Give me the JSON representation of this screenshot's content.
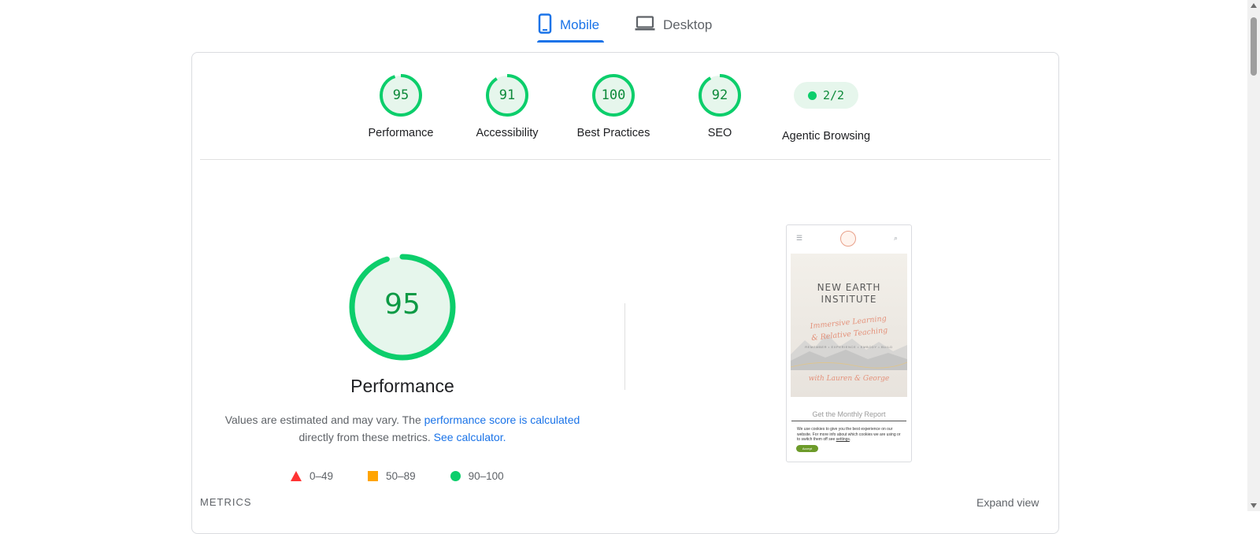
{
  "tabs": {
    "mobile": {
      "label": "Mobile",
      "icon": "smartphone-icon",
      "active": true
    },
    "desktop": {
      "label": "Desktop",
      "icon": "laptop-icon",
      "active": false
    }
  },
  "categories": [
    {
      "score": "95",
      "label": "Performance",
      "fraction": 0.95
    },
    {
      "score": "91",
      "label": "Accessibility",
      "fraction": 0.91
    },
    {
      "score": "100",
      "label": "Best Practices",
      "fraction": 1.0
    },
    {
      "score": "92",
      "label": "SEO",
      "fraction": 0.92
    }
  ],
  "agentic": {
    "value": "2/2",
    "label": "Agentic Browsing"
  },
  "performance": {
    "score": "95",
    "fraction": 0.95,
    "title": "Performance",
    "desc_part1": "Values are estimated and may vary. The ",
    "desc_link1": "performance score is calculated",
    "desc_part2": " directly from these metrics. ",
    "desc_link2": "See calculator."
  },
  "legend": {
    "fail": "0–49",
    "average": "50–89",
    "pass": "90–100"
  },
  "screenshot": {
    "title_line1": "NEW EARTH",
    "title_line2": "INSTITUTE",
    "script_line1": "Immersive Learning",
    "script_line2": "& Relative Teaching",
    "tagline": "REMEMBER • EXPERIENCE • EMBODY • BUILD",
    "author": "with Lauren & George",
    "report": "Get the Monthly Report",
    "cookie_text": "We use cookies to give you the best experience on our website. For more info about which cookies we are using or to switch them off see ",
    "cookie_link": "settings",
    "accept": "Accept"
  },
  "section": {
    "metrics": "METRICS",
    "expand": "Expand view"
  },
  "colors": {
    "pass": "#0cce6b",
    "average": "#ffa400",
    "fail": "#ff3333",
    "accent": "#1a73e8"
  }
}
